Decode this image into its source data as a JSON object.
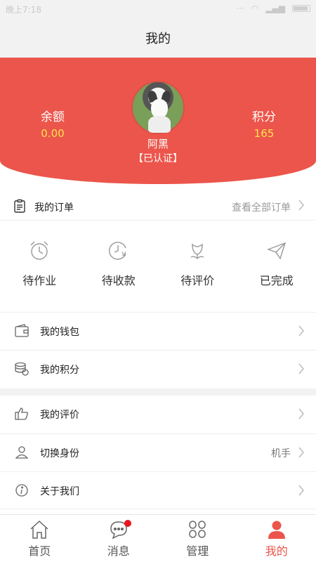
{
  "statusbar": {
    "time": "晚上7:18"
  },
  "header": {
    "title": "我的"
  },
  "profile": {
    "balance_label": "余额",
    "balance_value": "0.00",
    "points_label": "积分",
    "points_value": "165",
    "name": "阿黑",
    "status": "【已认证】"
  },
  "orders": {
    "label": "我的订单",
    "view_all": "查看全部订单",
    "items": [
      {
        "label": "待作业",
        "icon": "alarm-clock-icon"
      },
      {
        "label": "待收款",
        "icon": "clock-yen-icon"
      },
      {
        "label": "待评价",
        "icon": "flower-icon"
      },
      {
        "label": "已完成",
        "icon": "paper-plane-icon"
      }
    ]
  },
  "menu": {
    "wallet": "我的钱包",
    "points": "我的积分",
    "reviews": "我的评价",
    "switch_identity": "切换身份",
    "switch_identity_value": "机手",
    "about": "关于我们"
  },
  "tabbar": {
    "tabs": [
      {
        "label": "首页",
        "icon": "home-icon"
      },
      {
        "label": "消息",
        "icon": "chat-icon"
      },
      {
        "label": "管理",
        "icon": "grid-icon"
      },
      {
        "label": "我的",
        "icon": "person-icon"
      }
    ]
  },
  "colors": {
    "accent": "#ec554b",
    "value_yellow": "#ffe24d",
    "badge": "#e8141e"
  }
}
